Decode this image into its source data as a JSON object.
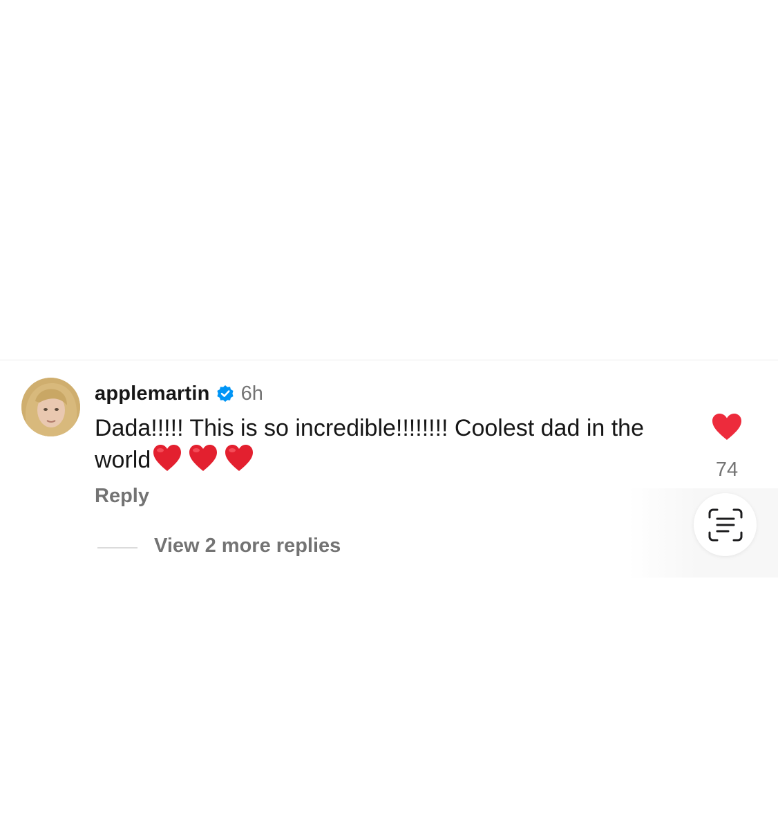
{
  "comment": {
    "username": "applemartin",
    "verified": true,
    "timestamp": "6h",
    "text": "Dada!!!!! This is so incredible!!!!!!!! Coolest dad in the world",
    "emoji_hearts": 3,
    "like_count": "74",
    "reply_label": "Reply",
    "view_replies_label": "View 2 more replies"
  },
  "icons": {
    "avatar": "avatar",
    "verified": "verified-badge-icon",
    "like": "heart-icon",
    "scan": "text-scan-icon",
    "emoji": "red-heart-emoji-icon"
  },
  "colors": {
    "username": "#161616",
    "secondary_text": "#737373",
    "verified_blue": "#0095f6",
    "heart_red": "#ed2b3c",
    "divider": "#ececec"
  }
}
